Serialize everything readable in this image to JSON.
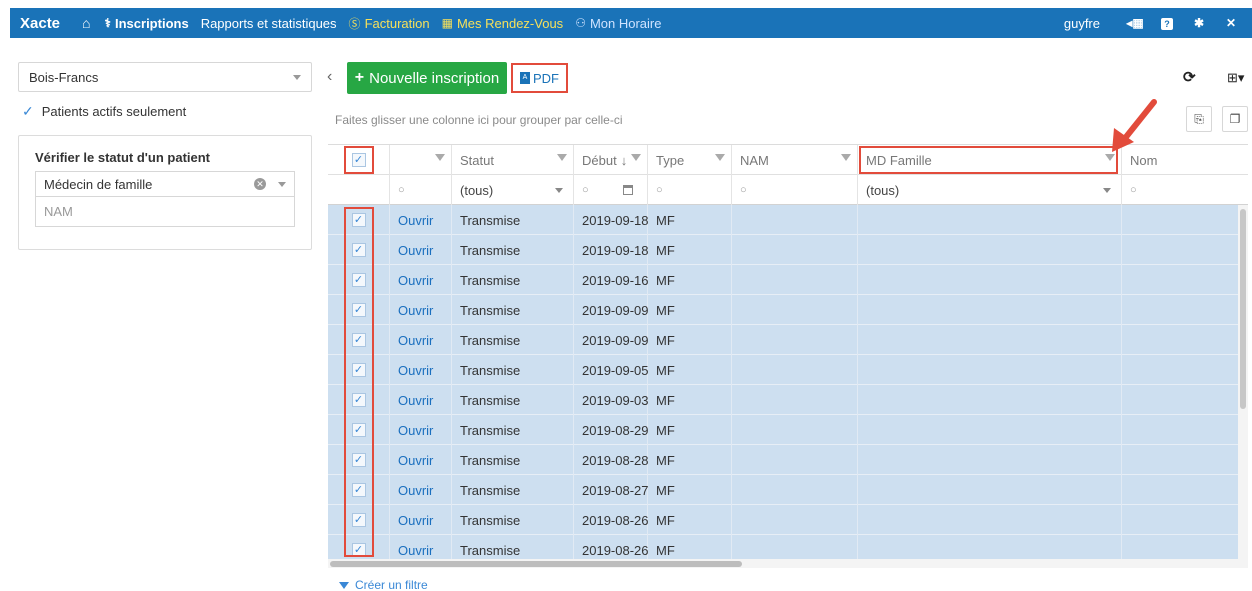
{
  "navbar": {
    "brand": "Xacte",
    "items": [
      {
        "label": "Inscriptions",
        "icon": "registrations-icon"
      },
      {
        "label": "Rapports et statistiques"
      },
      {
        "label": "Facturation",
        "icon": "dollar-icon"
      },
      {
        "label": "Mes Rendez-Vous",
        "icon": "calendar-icon"
      },
      {
        "label": "Mon Horaire",
        "icon": "users-icon"
      }
    ],
    "user": "guyfre",
    "color": "#1a73b8"
  },
  "sidebar": {
    "clinic": "Bois-Francs",
    "active_only_label": "Patients actifs seulement",
    "status_panel": {
      "title": "Vérifier le statut d'un patient",
      "type_value": "Médecin de famille",
      "nam_placeholder": "NAM"
    }
  },
  "toolbar": {
    "new_label": "Nouvelle inscription",
    "pdf_label": "PDF",
    "group_hint": "Faites glisser une colonne ici pour grouper par celle-ci"
  },
  "grid": {
    "columns": [
      "Statut",
      "Début",
      "Type",
      "NAM",
      "MD Famille",
      "Nom"
    ],
    "filters": {
      "statut": "(tous)",
      "md_famille": "(tous)"
    },
    "action_label": "Ouvrir",
    "rows": [
      {
        "statut": "Transmise",
        "debut": "2019-09-18",
        "type": "MF"
      },
      {
        "statut": "Transmise",
        "debut": "2019-09-18",
        "type": "MF"
      },
      {
        "statut": "Transmise",
        "debut": "2019-09-16",
        "type": "MF"
      },
      {
        "statut": "Transmise",
        "debut": "2019-09-09",
        "type": "MF"
      },
      {
        "statut": "Transmise",
        "debut": "2019-09-09",
        "type": "MF"
      },
      {
        "statut": "Transmise",
        "debut": "2019-09-05",
        "type": "MF"
      },
      {
        "statut": "Transmise",
        "debut": "2019-09-03",
        "type": "MF"
      },
      {
        "statut": "Transmise",
        "debut": "2019-08-29",
        "type": "MF"
      },
      {
        "statut": "Transmise",
        "debut": "2019-08-28",
        "type": "MF"
      },
      {
        "statut": "Transmise",
        "debut": "2019-08-27",
        "type": "MF"
      },
      {
        "statut": "Transmise",
        "debut": "2019-08-26",
        "type": "MF"
      },
      {
        "statut": "Transmise",
        "debut": "2019-08-26",
        "type": "MF"
      }
    ],
    "selected_row_color": "#cddff0"
  },
  "footer": {
    "create_filter": "Créer un filtre"
  },
  "annotation_color": "#e24b3b"
}
